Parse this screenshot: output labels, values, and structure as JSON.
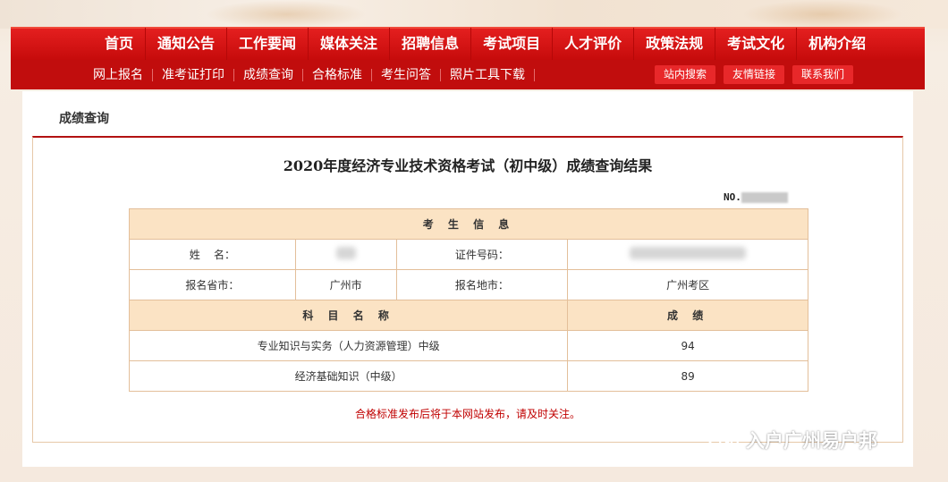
{
  "nav": {
    "main": [
      "首页",
      "通知公告",
      "工作要闻",
      "媒体关注",
      "招聘信息",
      "考试项目",
      "人才评价",
      "政策法规",
      "考试文化",
      "机构介绍"
    ],
    "sub": [
      "网上报名",
      "准考证打印",
      "成绩查询",
      "合格标准",
      "考生问答",
      "照片工具下载"
    ],
    "buttons": [
      "站内搜索",
      "友情链接",
      "联系我们"
    ]
  },
  "breadcrumb": "成绩查询",
  "result": {
    "title": "2020年度经济专业技术资格考试（初中级）成绩查询结果",
    "no_label": "NO.",
    "section_candidate": "考 生 信 息",
    "name_label": "姓    名：",
    "id_label": "证件号码：",
    "province_label": "报名省市：",
    "province_value": "广州市",
    "area_label": "报名地市：",
    "area_value": "广州考区",
    "subject_header": "科 目 名 称",
    "score_header": "成 绩",
    "subjects": [
      {
        "name": "专业知识与实务（人力资源管理）中级",
        "score": "94"
      },
      {
        "name": "经济基础知识（中级）",
        "score": "89"
      }
    ],
    "note": "合格标准发布后将于本网站发布，请及时关注。"
  },
  "watermark": "入户广州易户邦",
  "colors": {
    "brand_red": "#c60b0b",
    "header_bg": "#fbe3c4",
    "note_red": "#c00000"
  }
}
